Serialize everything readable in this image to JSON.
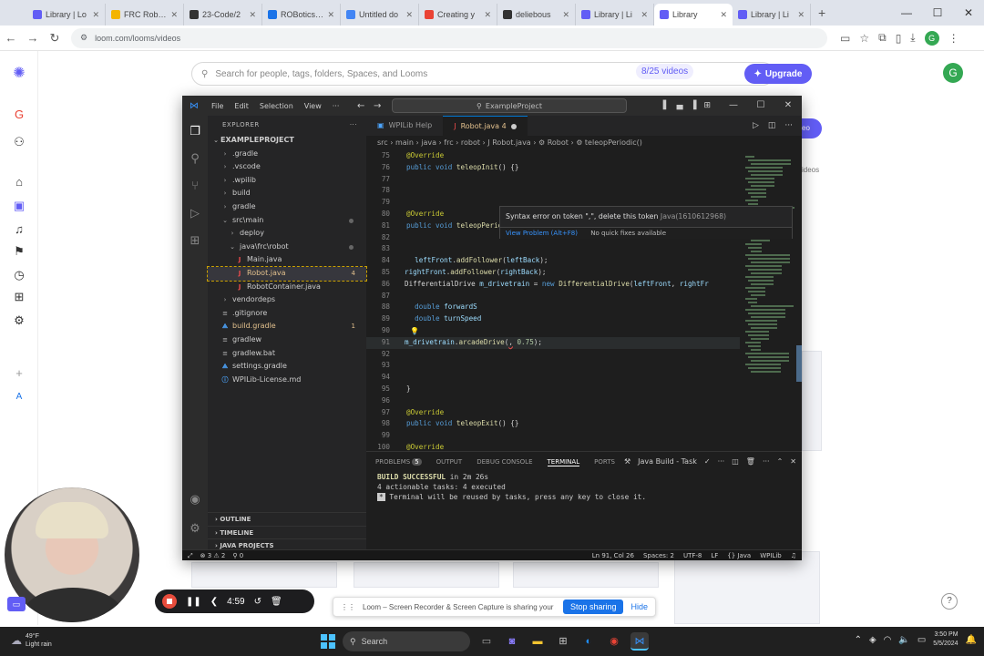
{
  "browser": {
    "tabs": [
      {
        "label": "Library | Lo",
        "color": "#625df5"
      },
      {
        "label": "FRC Robotic",
        "color": "#f4b400"
      },
      {
        "label": "23-Code/2",
        "color": "#333333"
      },
      {
        "label": "ROBotics Cr",
        "color": "#1a73e8"
      },
      {
        "label": "Untitled do",
        "color": "#4285f4"
      },
      {
        "label": "Creating y",
        "color": "#ea4335"
      },
      {
        "label": "deliebous",
        "color": "#333333"
      },
      {
        "label": "Library | Li",
        "color": "#625df5"
      },
      {
        "label": "Library",
        "color": "#625df5",
        "active": true
      },
      {
        "label": "Library | Li",
        "color": "#625df5"
      }
    ],
    "new_tab": "+",
    "url": "loom.com/looms/videos"
  },
  "loom": {
    "search_placeholder": "Search for people, tags, folders, Spaces, and Looms",
    "videos_count": "8/25 videos",
    "upgrade_label": "Upgrade",
    "avatar_initial": "G",
    "peek_label": "eo",
    "peek_text": "ideos"
  },
  "vscode": {
    "menu": [
      "File",
      "Edit",
      "Selection",
      "View",
      "···"
    ],
    "command_center": "ExampleProject",
    "explorer_title": "EXPLORER",
    "project": "EXAMPLEPROJECT",
    "tree": [
      {
        "label": ".gradle",
        "indent": 1,
        "kind": "folder"
      },
      {
        "label": ".vscode",
        "indent": 1,
        "kind": "folder"
      },
      {
        "label": ".wpilib",
        "indent": 1,
        "kind": "folder"
      },
      {
        "label": "build",
        "indent": 1,
        "kind": "folder"
      },
      {
        "label": "gradle",
        "indent": 1,
        "kind": "folder"
      },
      {
        "label": "src\\main",
        "indent": 1,
        "kind": "open",
        "dot": true
      },
      {
        "label": "deploy",
        "indent": 2,
        "kind": "folder"
      },
      {
        "label": "java\\frc\\robot",
        "indent": 2,
        "kind": "open",
        "dot": true
      },
      {
        "label": "Main.java",
        "indent": 3,
        "kind": "java"
      },
      {
        "label": "Robot.java",
        "indent": 3,
        "kind": "java",
        "badge": "4",
        "selected": true
      },
      {
        "label": "RobotContainer.java",
        "indent": 3,
        "kind": "java"
      },
      {
        "label": "vendordeps",
        "indent": 1,
        "kind": "folder"
      },
      {
        "label": ".gitignore",
        "indent": 1,
        "kind": "file"
      },
      {
        "label": "build.gradle",
        "indent": 1,
        "kind": "gradle",
        "badge": "1"
      },
      {
        "label": "gradlew",
        "indent": 1,
        "kind": "file"
      },
      {
        "label": "gradlew.bat",
        "indent": 1,
        "kind": "file"
      },
      {
        "label": "settings.gradle",
        "indent": 1,
        "kind": "gradle"
      },
      {
        "label": "WPILib-License.md",
        "indent": 1,
        "kind": "md"
      }
    ],
    "sections": [
      "OUTLINE",
      "TIMELINE",
      "JAVA PROJECTS"
    ],
    "editor_tabs": [
      {
        "label": "WPILib Help",
        "active": false
      },
      {
        "label": "Robot.java 4",
        "active": true
      }
    ],
    "breadcrumb": "src › main › java › frc › robot › J Robot.java › ⚙ Robot › ⚙ teleopPeriodic()",
    "code": [
      {
        "n": "75",
        "html": "<span class='ann'>@Override</span>"
      },
      {
        "n": "76",
        "html": "<span class='kw'>public void</span> <span class='fn'>teleopInit</span>() {}"
      },
      {
        "n": "77",
        "html": ""
      },
      {
        "n": "78",
        "html": ""
      },
      {
        "n": "79",
        "html": ""
      },
      {
        "n": "80",
        "html": "<span class='ann'>@Override</span>"
      },
      {
        "n": "81",
        "html": "<span class='kw'>public void</span> <span class='fn'>teleopPeriodic</span>() {"
      },
      {
        "n": "82",
        "html": ""
      },
      {
        "n": "83",
        "html": ""
      },
      {
        "n": "84",
        "html": "  <span class='var'>leftFront</span>.<span class='fn'>addFollower</span>(<span class='var'>leftBack</span>);"
      },
      {
        "n": "85",
        "cont": true,
        "html": "<span class='var'>rightFront</span>.<span class='fn'>addFollower</span>(<span class='var'>rightBack</span>);"
      },
      {
        "n": "86",
        "cont": true,
        "html": "DifferentialDrive <span class='var'>m_drivetrain</span> = <span class='kw'>new</span> <span class='fn'>DifferentialDrive</span>(<span class='var'>leftFront</span>, <span class='var'>rightFr</span>"
      },
      {
        "n": "87",
        "html": ""
      },
      {
        "n": "88",
        "html": "  <span class='kw'>double</span> <span class='var'>forwardS</span>"
      },
      {
        "n": "89",
        "html": "  <span class='kw'>double</span> <span class='var'>turnSpeed</span>"
      },
      {
        "n": "90",
        "html": "",
        "bulb": true
      },
      {
        "n": "91",
        "cont": true,
        "html": "<span class='var'>m_drivetrain</span>.<span class='fn'>arcadeDrive</span>(<span class='squiggle'>,</span> <span class='num'>0.75</span>);",
        "highlight": true
      },
      {
        "n": "92",
        "html": ""
      },
      {
        "n": "93",
        "html": ""
      },
      {
        "n": "94",
        "html": ""
      },
      {
        "n": "95",
        "html": "}"
      },
      {
        "n": "96",
        "html": ""
      },
      {
        "n": "97",
        "html": "<span class='ann'>@Override</span>"
      },
      {
        "n": "98",
        "html": "<span class='kw'>public void</span> <span class='fn'>teleopExit</span>() {}"
      },
      {
        "n": "99",
        "html": ""
      },
      {
        "n": "100",
        "html": "<span class='ann'>@Override</span>"
      }
    ],
    "hover": {
      "message": "Syntax error on token \",\", delete this token",
      "source": "Java(1610612968)",
      "view_problem": "View Problem (Alt+F8)",
      "no_fixes": "No quick fixes available"
    },
    "panel_tabs": [
      {
        "label": "PROBLEMS",
        "count": "5"
      },
      {
        "label": "OUTPUT"
      },
      {
        "label": "DEBUG CONSOLE"
      },
      {
        "label": "TERMINAL",
        "active": true
      },
      {
        "label": "PORTS"
      }
    ],
    "task_label": "Java Build - Task",
    "terminal": {
      "line1_prefix": "BUILD SUCCESSFUL",
      "line1_rest": " in 2m 26s",
      "line2": "4 actionable tasks: 4 executed",
      "line3": " Terminal will be reused by tasks, press any key to close it."
    },
    "status": {
      "problems": "⊗ 3 ⚠ 2",
      "ports": "⚲ 0",
      "position": "Ln 91, Col 26",
      "spaces": "Spaces: 2",
      "encoding": "UTF-8",
      "eol": "LF",
      "language": "{} Java",
      "wpilib": "WPILib"
    }
  },
  "recorder": {
    "time": "4:59",
    "share_message": "Loom – Screen Recorder & Screen Capture is sharing your screen.",
    "stop_sharing": "Stop sharing",
    "hide": "Hide"
  },
  "taskbar": {
    "weather_temp": "49°F",
    "weather_desc": "Light rain",
    "search": "Search",
    "time": "3:50 PM",
    "date": "5/5/2024"
  }
}
